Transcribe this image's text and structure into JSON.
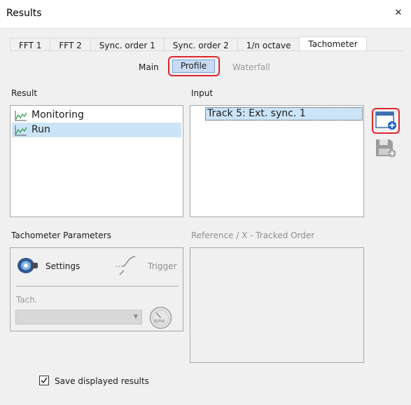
{
  "window": {
    "title": "Results",
    "close_glyph": "✕"
  },
  "tabs": [
    {
      "label": "FFT 1",
      "active": false
    },
    {
      "label": "FFT 2",
      "active": false
    },
    {
      "label": "Sync. order 1",
      "active": false
    },
    {
      "label": "Sync. order 2",
      "active": false
    },
    {
      "label": "1/n octave",
      "active": false
    },
    {
      "label": "Tachometer",
      "active": true
    }
  ],
  "subtabs": {
    "main": "Main",
    "profile": "Profile",
    "waterfall": "Waterfall",
    "selected": "Profile"
  },
  "result": {
    "label": "Result",
    "items": [
      {
        "label": "Monitoring",
        "icon": "line-chart-icon",
        "selected": false
      },
      {
        "label": "Run",
        "icon": "line-chart-icon",
        "selected": true
      }
    ]
  },
  "input": {
    "label": "Input",
    "items": [
      {
        "label": "Track 5: Ext. sync. 1",
        "selected": true
      }
    ]
  },
  "side_buttons": {
    "add_window": "add-window-icon",
    "save": "save-add-icon"
  },
  "tachometer_params": {
    "label": "Tachometer  Parameters",
    "settings_label": "Settings",
    "trigger_label": "Trigger",
    "tach_label": "Tach.",
    "tach_value": "",
    "rpm_label": "RPM"
  },
  "reference": {
    "label": "Reference / X   -   Tracked Order"
  },
  "save_results": {
    "label": "Save displayed results",
    "checked": true
  },
  "colors": {
    "highlight_red": "#e0262e",
    "selection_blue": "#cce4f7",
    "chart_green": "#2e9e4a"
  }
}
